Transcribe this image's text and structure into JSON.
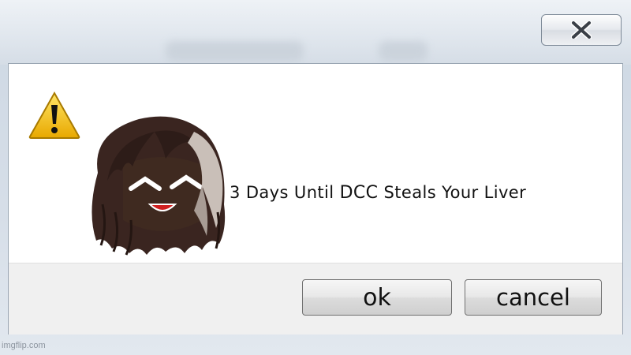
{
  "dialog": {
    "message_before": "3 Days Until ",
    "message_name": "DCC",
    "message_after": " Steals Your Liver"
  },
  "buttons": {
    "ok_label": "ok",
    "cancel_label": "cancel"
  },
  "icons": {
    "warning": "warning-triangle-icon",
    "close": "close-icon"
  },
  "colors": {
    "warning_yellow": "#f5c400",
    "frame": "#d6dee8"
  },
  "watermark": "imgflip.com"
}
